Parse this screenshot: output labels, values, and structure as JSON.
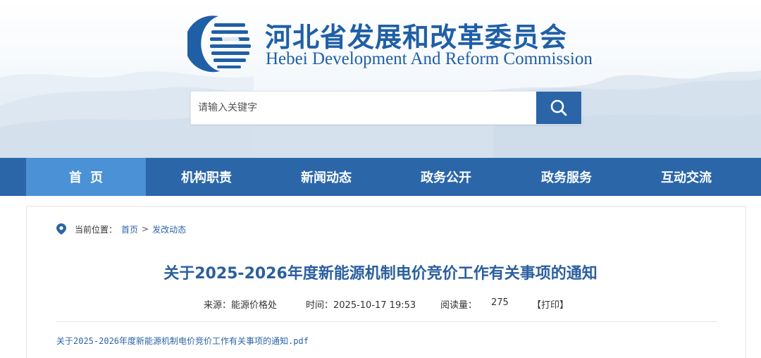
{
  "header": {
    "title_cn": "河北省发展和改革委员会",
    "title_en": "Hebei Development And Reform Commission",
    "logo_icon": "hebei-drc-emblem",
    "brand_color": "#1f5fa6"
  },
  "search": {
    "placeholder": "请输入关键字",
    "button_icon": "search-icon",
    "button_color": "#2b64a7"
  },
  "nav": {
    "items": [
      {
        "label": "首页",
        "active": true
      },
      {
        "label": "机构职责",
        "active": false
      },
      {
        "label": "新闻动态",
        "active": false
      },
      {
        "label": "政务公开",
        "active": false
      },
      {
        "label": "政务服务",
        "active": false
      },
      {
        "label": "互动交流",
        "active": false
      }
    ],
    "bar_color": "#2b66a9",
    "active_color": "#4b91d6"
  },
  "breadcrumb": {
    "icon": "location-pin-icon",
    "prefix": "当前位置：",
    "home": "首页",
    "separator": ">",
    "section": "发改动态"
  },
  "article": {
    "title": "关于2025-2026年度新能源机制电价竞价工作有关事项的通知",
    "source": "来源：能源价格处",
    "time": "时间：2025-10-17 19:53",
    "views_label": "阅读量：",
    "views": "275",
    "print": "【打印】",
    "attachment": "关于2025-2026年度新能源机制电价竞价工作有关事项的通知.pdf"
  }
}
